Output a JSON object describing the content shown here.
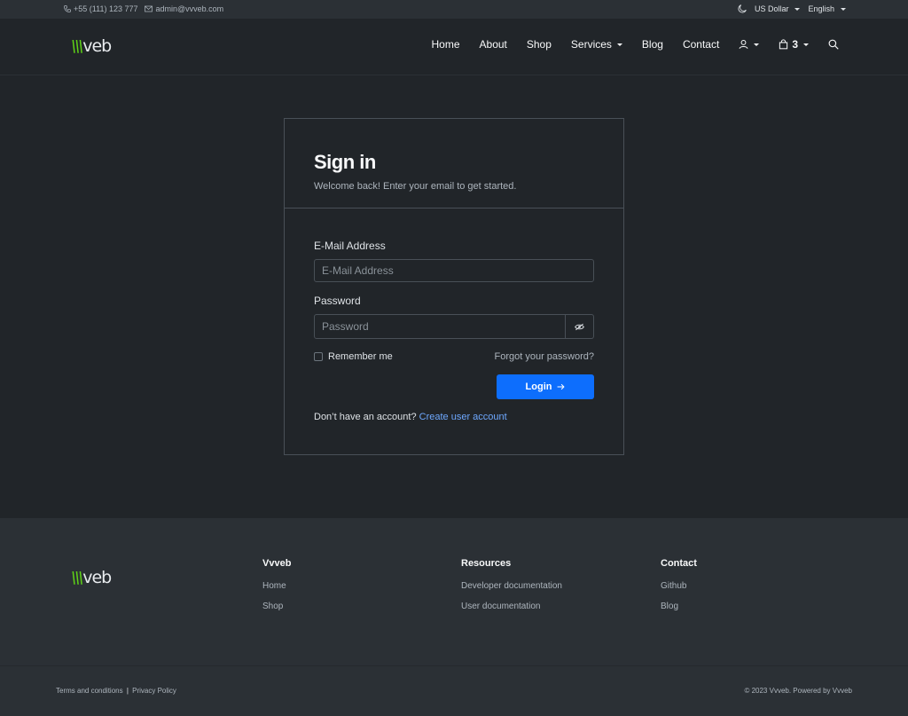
{
  "topbar": {
    "phone": "+55 (111) 123 777",
    "email": "admin@vvveb.com",
    "currency": "US Dollar",
    "language": "English"
  },
  "brand": {
    "logo_slash": "\\\\\\",
    "logo_text": "veb"
  },
  "nav": {
    "items": [
      "Home",
      "About",
      "Shop",
      "Services",
      "Blog",
      "Contact"
    ],
    "cart_count": "3"
  },
  "signin": {
    "title": "Sign in",
    "subtitle": "Welcome back! Enter your email to get started.",
    "email_label": "E-Mail Address",
    "email_placeholder": "E-Mail Address",
    "email_value": "",
    "password_label": "Password",
    "password_placeholder": "Password",
    "password_value": "",
    "remember_label": "Remember me",
    "forgot_label": "Forgot your password?",
    "login_label": "Login",
    "no_account_text": "Don’t have an account?",
    "create_account_label": "Create user account"
  },
  "footer": {
    "col1": {
      "heading": "Vvveb",
      "links": [
        "Home",
        "Shop"
      ]
    },
    "col2": {
      "heading": "Resources",
      "links": [
        "Developer documentation",
        "User documentation"
      ]
    },
    "col3": {
      "heading": "Contact",
      "links": [
        "Github",
        "Blog"
      ]
    }
  },
  "bottombar": {
    "terms": "Terms and conditions",
    "separator": "|",
    "privacy": "Privacy Policy",
    "copyright": "© 2023 Vvveb. Powered by Vvveb"
  },
  "colors": {
    "accent": "#0d6efd",
    "link": "#6ea8fe",
    "logo_green": "#5fd317",
    "background": "#212529",
    "panel": "#2b3035"
  },
  "icons": [
    "phone-icon",
    "envelope-icon",
    "moon-icon",
    "user-icon",
    "bag-icon",
    "search-icon",
    "eye-slash-icon",
    "arrow-right-icon"
  ]
}
